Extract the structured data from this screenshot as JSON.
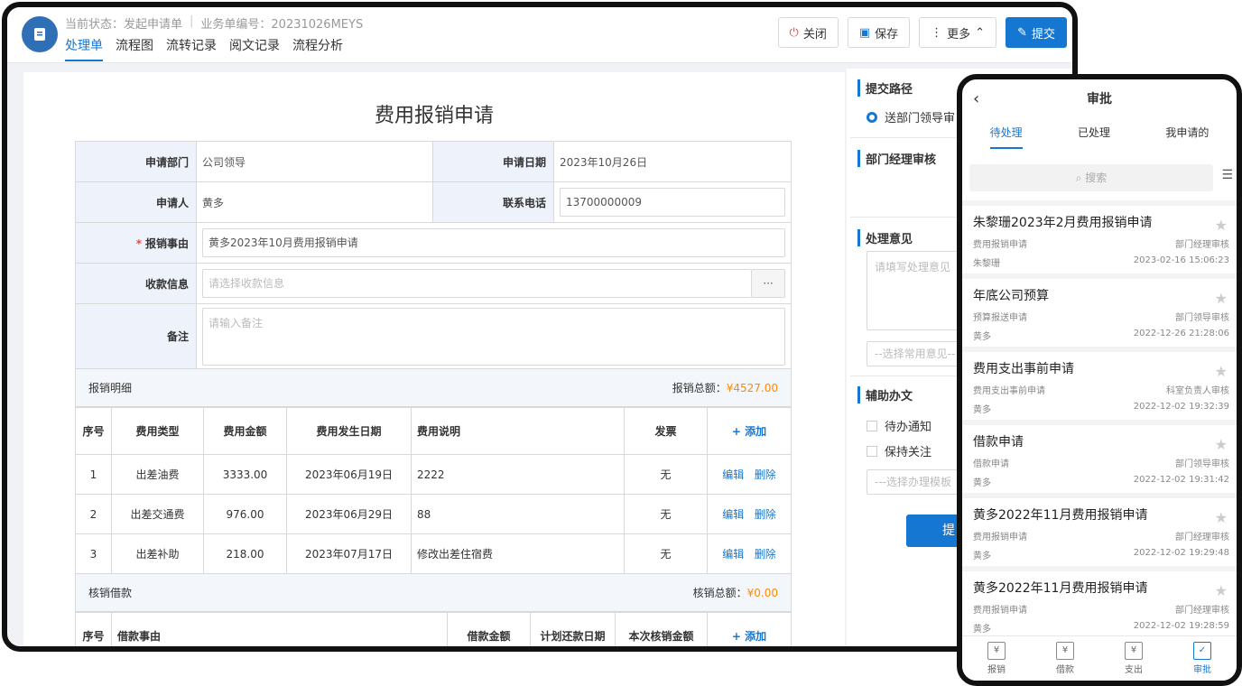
{
  "header": {
    "status_label": "当前状态：发起申请单",
    "biz_label": "业务单编号：20231026MEYS",
    "tabs": [
      "处理单",
      "流程图",
      "流转记录",
      "阅文记录",
      "流程分析"
    ],
    "buttons": {
      "close": "关闭",
      "save": "保存",
      "more": "更多",
      "submit": "提交"
    }
  },
  "form": {
    "title": "费用报销申请",
    "dept_label": "申请部门",
    "dept": "公司领导",
    "date_label": "申请日期",
    "date": "2023年10月26日",
    "applicant_label": "申请人",
    "applicant": "黄多",
    "phone_label": "联系电话",
    "phone": "13700000009",
    "reason_label": "报销事由",
    "reason": "黄多2023年10月费用报销申请",
    "payee_label": "收款信息",
    "payee_placeholder": "请选择收款信息",
    "payee_btn": "···",
    "remark_label": "备注",
    "remark_placeholder": "请输入备注"
  },
  "detail": {
    "title": "报销明细",
    "total_label": "报销总额：",
    "total": "¥4527.00",
    "headers": [
      "序号",
      "费用类型",
      "费用金额",
      "费用发生日期",
      "费用说明",
      "发票",
      "+ 添加"
    ],
    "rows": [
      {
        "no": "1",
        "type": "出差油费",
        "amount": "3333.00",
        "date": "2023年06月19日",
        "desc": "2222",
        "invoice": "无"
      },
      {
        "no": "2",
        "type": "出差交通费",
        "amount": "976.00",
        "date": "2023年06月29日",
        "desc": "88",
        "invoice": "无"
      },
      {
        "no": "3",
        "type": "出差补助",
        "amount": "218.00",
        "date": "2023年07月17日",
        "desc": "修改出差住宿费",
        "invoice": "无"
      }
    ],
    "edit": "编辑",
    "delete": "删除"
  },
  "loan": {
    "title": "核销借款",
    "total_label": "核销总额：",
    "total": "¥0.00",
    "headers": [
      "序号",
      "借款事由",
      "借款金额",
      "计划还款日期",
      "本次核销金额",
      "+ 添加"
    ]
  },
  "side": {
    "path_title": "提交路径",
    "path_option": "送部门领导审",
    "step_title": "部门经理审核",
    "opinion_title": "处理意见",
    "opinion_placeholder": "请填写处理意见",
    "common_placeholder": "--选择常用意见--",
    "assist_title": "辅助办文",
    "notify": "待办通知",
    "follow": "保持关注",
    "assist_placeholder": "---选择办理模板",
    "submit": "提"
  },
  "phone": {
    "title": "审批",
    "tabs": [
      "待处理",
      "已处理",
      "我申请的"
    ],
    "search": "搜索",
    "items": [
      {
        "title": "朱黎珊2023年2月费用报销申请",
        "type": "费用报销申请",
        "node": "部门经理审核",
        "user": "朱黎珊",
        "time": "2023-02-16 15:06:23"
      },
      {
        "title": "年底公司预算",
        "type": "预算报送申请",
        "node": "部门领导审核",
        "user": "黄多",
        "time": "2022-12-26 21:28:06"
      },
      {
        "title": "费用支出事前申请",
        "type": "费用支出事前申请",
        "node": "科室负责人审核",
        "user": "黄多",
        "time": "2022-12-02 19:32:39"
      },
      {
        "title": "借款申请",
        "type": "借款申请",
        "node": "部门领导审核",
        "user": "黄多",
        "time": "2022-12-02 19:31:42"
      },
      {
        "title": "黄多2022年11月费用报销申请",
        "type": "费用报销申请",
        "node": "部门经理审核",
        "user": "黄多",
        "time": "2022-12-02 19:29:48"
      },
      {
        "title": "黄多2022年11月费用报销申请",
        "type": "费用报销申请",
        "node": "部门经理审核",
        "user": "黄多",
        "time": "2022-12-02 19:28:59"
      }
    ],
    "nav": [
      "报销",
      "借款",
      "支出",
      "审批"
    ]
  }
}
